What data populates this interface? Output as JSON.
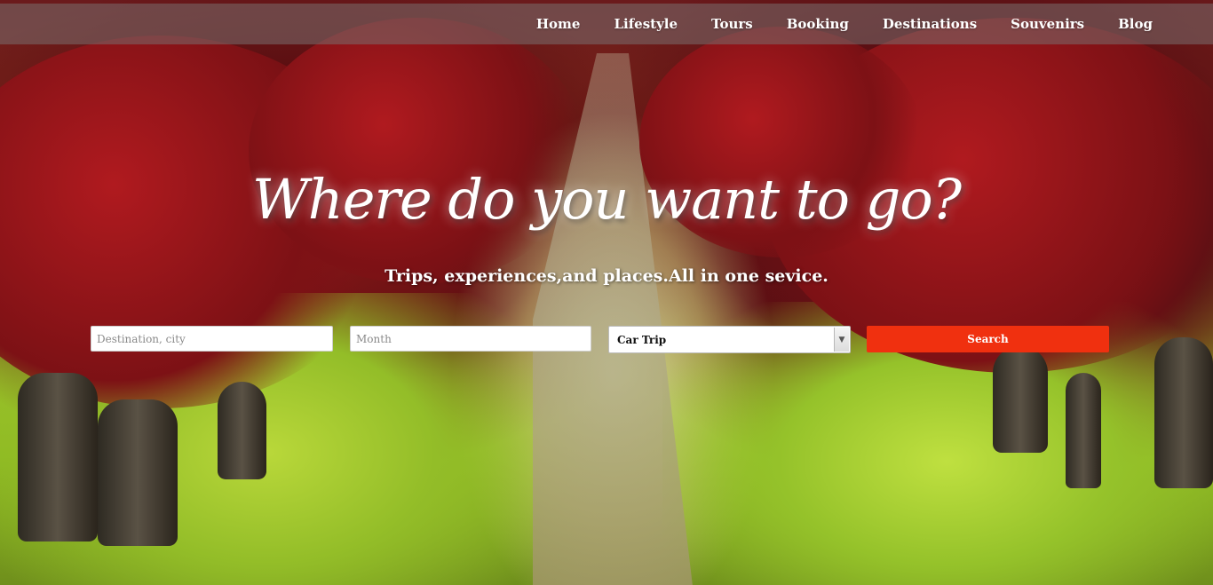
{
  "nav": {
    "items": [
      {
        "label": "Home"
      },
      {
        "label": "Lifestyle"
      },
      {
        "label": "Tours"
      },
      {
        "label": "Booking"
      },
      {
        "label": "Destinations"
      },
      {
        "label": "Souvenirs"
      },
      {
        "label": "Blog"
      }
    ]
  },
  "hero": {
    "headline": "Where do you want to go?",
    "subheadline": "Trips, experiences,and places.All in one sevice."
  },
  "search": {
    "destination_placeholder": "Destination, city",
    "month_placeholder": "Month",
    "trip_type_selected": "Car Trip",
    "button_label": "Search"
  },
  "colors": {
    "accent_button": "#f0300f",
    "nav_bar": "rgba(120,110,110,0.55)",
    "text_light": "#ffffff"
  },
  "icons": {
    "select_arrow": "chevron-down-icon"
  }
}
